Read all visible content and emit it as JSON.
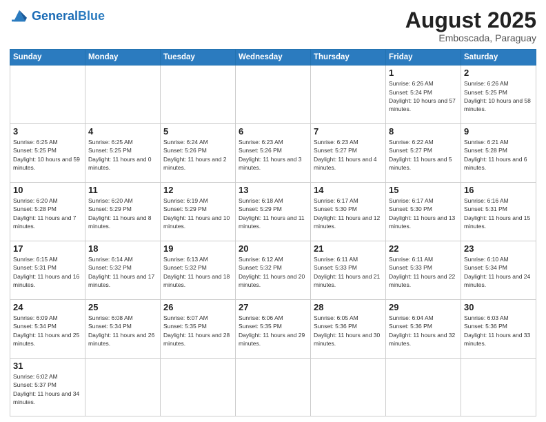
{
  "header": {
    "logo_general": "General",
    "logo_blue": "Blue",
    "month_title": "August 2025",
    "subtitle": "Emboscada, Paraguay"
  },
  "days_of_week": [
    "Sunday",
    "Monday",
    "Tuesday",
    "Wednesday",
    "Thursday",
    "Friday",
    "Saturday"
  ],
  "rows": [
    [
      {
        "day": "",
        "empty": true
      },
      {
        "day": "",
        "empty": true
      },
      {
        "day": "",
        "empty": true
      },
      {
        "day": "",
        "empty": true
      },
      {
        "day": "",
        "empty": true
      },
      {
        "day": "1",
        "sunrise": "6:26 AM",
        "sunset": "5:24 PM",
        "daylight": "10 hours and 57 minutes."
      },
      {
        "day": "2",
        "sunrise": "6:26 AM",
        "sunset": "5:25 PM",
        "daylight": "10 hours and 58 minutes."
      }
    ],
    [
      {
        "day": "3",
        "sunrise": "6:25 AM",
        "sunset": "5:25 PM",
        "daylight": "10 hours and 59 minutes."
      },
      {
        "day": "4",
        "sunrise": "6:25 AM",
        "sunset": "5:25 PM",
        "daylight": "11 hours and 0 minutes."
      },
      {
        "day": "5",
        "sunrise": "6:24 AM",
        "sunset": "5:26 PM",
        "daylight": "11 hours and 2 minutes."
      },
      {
        "day": "6",
        "sunrise": "6:23 AM",
        "sunset": "5:26 PM",
        "daylight": "11 hours and 3 minutes."
      },
      {
        "day": "7",
        "sunrise": "6:23 AM",
        "sunset": "5:27 PM",
        "daylight": "11 hours and 4 minutes."
      },
      {
        "day": "8",
        "sunrise": "6:22 AM",
        "sunset": "5:27 PM",
        "daylight": "11 hours and 5 minutes."
      },
      {
        "day": "9",
        "sunrise": "6:21 AM",
        "sunset": "5:28 PM",
        "daylight": "11 hours and 6 minutes."
      }
    ],
    [
      {
        "day": "10",
        "sunrise": "6:20 AM",
        "sunset": "5:28 PM",
        "daylight": "11 hours and 7 minutes."
      },
      {
        "day": "11",
        "sunrise": "6:20 AM",
        "sunset": "5:29 PM",
        "daylight": "11 hours and 8 minutes."
      },
      {
        "day": "12",
        "sunrise": "6:19 AM",
        "sunset": "5:29 PM",
        "daylight": "11 hours and 10 minutes."
      },
      {
        "day": "13",
        "sunrise": "6:18 AM",
        "sunset": "5:29 PM",
        "daylight": "11 hours and 11 minutes."
      },
      {
        "day": "14",
        "sunrise": "6:17 AM",
        "sunset": "5:30 PM",
        "daylight": "11 hours and 12 minutes."
      },
      {
        "day": "15",
        "sunrise": "6:17 AM",
        "sunset": "5:30 PM",
        "daylight": "11 hours and 13 minutes."
      },
      {
        "day": "16",
        "sunrise": "6:16 AM",
        "sunset": "5:31 PM",
        "daylight": "11 hours and 15 minutes."
      }
    ],
    [
      {
        "day": "17",
        "sunrise": "6:15 AM",
        "sunset": "5:31 PM",
        "daylight": "11 hours and 16 minutes."
      },
      {
        "day": "18",
        "sunrise": "6:14 AM",
        "sunset": "5:32 PM",
        "daylight": "11 hours and 17 minutes."
      },
      {
        "day": "19",
        "sunrise": "6:13 AM",
        "sunset": "5:32 PM",
        "daylight": "11 hours and 18 minutes."
      },
      {
        "day": "20",
        "sunrise": "6:12 AM",
        "sunset": "5:32 PM",
        "daylight": "11 hours and 20 minutes."
      },
      {
        "day": "21",
        "sunrise": "6:11 AM",
        "sunset": "5:33 PM",
        "daylight": "11 hours and 21 minutes."
      },
      {
        "day": "22",
        "sunrise": "6:11 AM",
        "sunset": "5:33 PM",
        "daylight": "11 hours and 22 minutes."
      },
      {
        "day": "23",
        "sunrise": "6:10 AM",
        "sunset": "5:34 PM",
        "daylight": "11 hours and 24 minutes."
      }
    ],
    [
      {
        "day": "24",
        "sunrise": "6:09 AM",
        "sunset": "5:34 PM",
        "daylight": "11 hours and 25 minutes."
      },
      {
        "day": "25",
        "sunrise": "6:08 AM",
        "sunset": "5:34 PM",
        "daylight": "11 hours and 26 minutes."
      },
      {
        "day": "26",
        "sunrise": "6:07 AM",
        "sunset": "5:35 PM",
        "daylight": "11 hours and 28 minutes."
      },
      {
        "day": "27",
        "sunrise": "6:06 AM",
        "sunset": "5:35 PM",
        "daylight": "11 hours and 29 minutes."
      },
      {
        "day": "28",
        "sunrise": "6:05 AM",
        "sunset": "5:36 PM",
        "daylight": "11 hours and 30 minutes."
      },
      {
        "day": "29",
        "sunrise": "6:04 AM",
        "sunset": "5:36 PM",
        "daylight": "11 hours and 32 minutes."
      },
      {
        "day": "30",
        "sunrise": "6:03 AM",
        "sunset": "5:36 PM",
        "daylight": "11 hours and 33 minutes."
      }
    ],
    [
      {
        "day": "31",
        "sunrise": "6:02 AM",
        "sunset": "5:37 PM",
        "daylight": "11 hours and 34 minutes."
      },
      {
        "day": "",
        "empty": true
      },
      {
        "day": "",
        "empty": true
      },
      {
        "day": "",
        "empty": true
      },
      {
        "day": "",
        "empty": true
      },
      {
        "day": "",
        "empty": true
      },
      {
        "day": "",
        "empty": true
      }
    ]
  ]
}
